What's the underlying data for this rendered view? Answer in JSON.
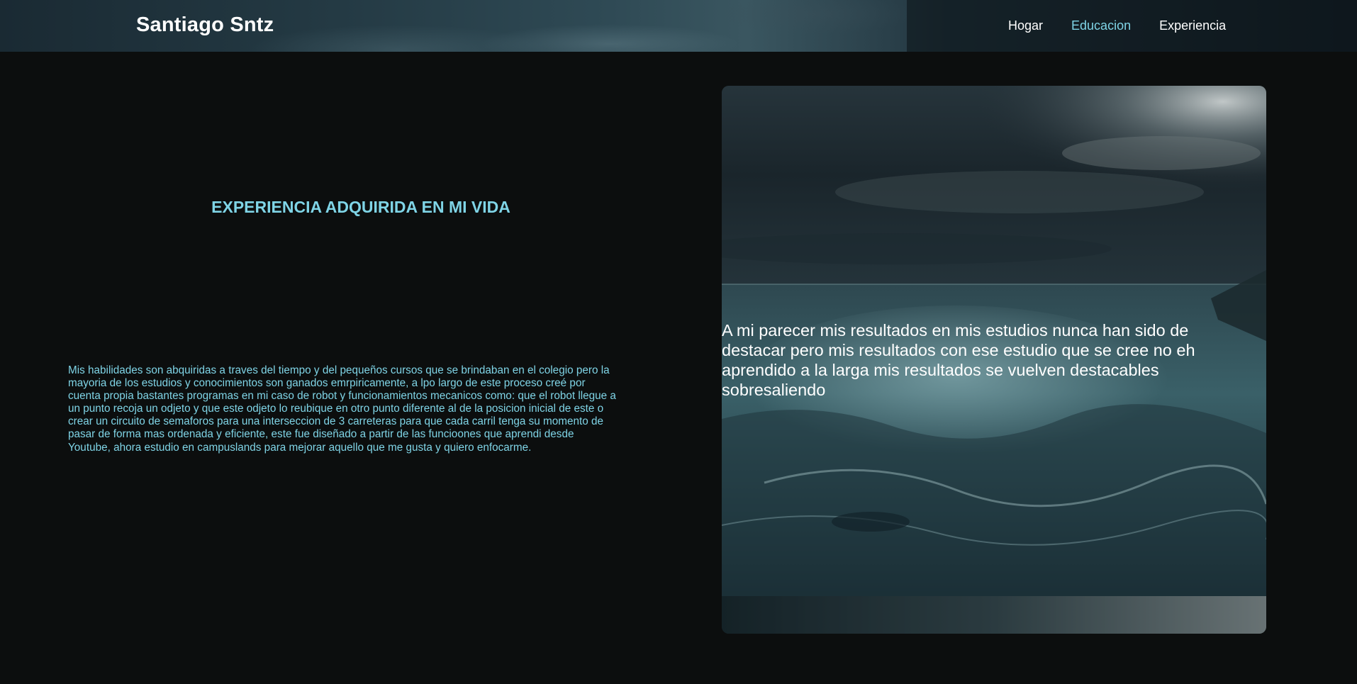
{
  "header": {
    "logo": "Santiago Sntz",
    "nav": [
      {
        "label": "Hogar",
        "active": false
      },
      {
        "label": "Educacion",
        "active": true
      },
      {
        "label": "Experiencia",
        "active": false
      }
    ]
  },
  "main": {
    "title": "EXPERIENCIA ADQUIRIDA EN MI VIDA",
    "paragraph": "Mis habilidades son abquiridas a traves del tiempo y del pequeños cursos que se brindaban en el colegio pero la mayoria de los estudios y conocimientos son ganados emrpiricamente, a lpo largo de este proceso creé por cuenta propia bastantes programas en mi caso de robot y funcionamientos mecanicos como: que el robot llegue a un punto recoja un odjeto y que este odjeto lo reubique en otro punto diferente al de la posicion inicial de este o crear un circuito de semaforos para una interseccion de 3 carreteras para que cada carril tenga su momento de pasar de forma mas ordenada y eficiente, este fue diseñado a partir de las funcioones que aprendi desde Youtube, ahora estudio en campuslands para mejorar aquello que me gusta y quiero enfocarme.",
    "card_text": "A mi parecer mis resultados en mis estudios nunca han sido de destacar pero mis resultados con ese estudio que se cree no eh aprendido a la larga mis resultados se vuelven destacables sobresaliendo"
  },
  "colors": {
    "accent": "#7fd4e6",
    "background": "#0c0e0e",
    "text": "#ffffff"
  }
}
